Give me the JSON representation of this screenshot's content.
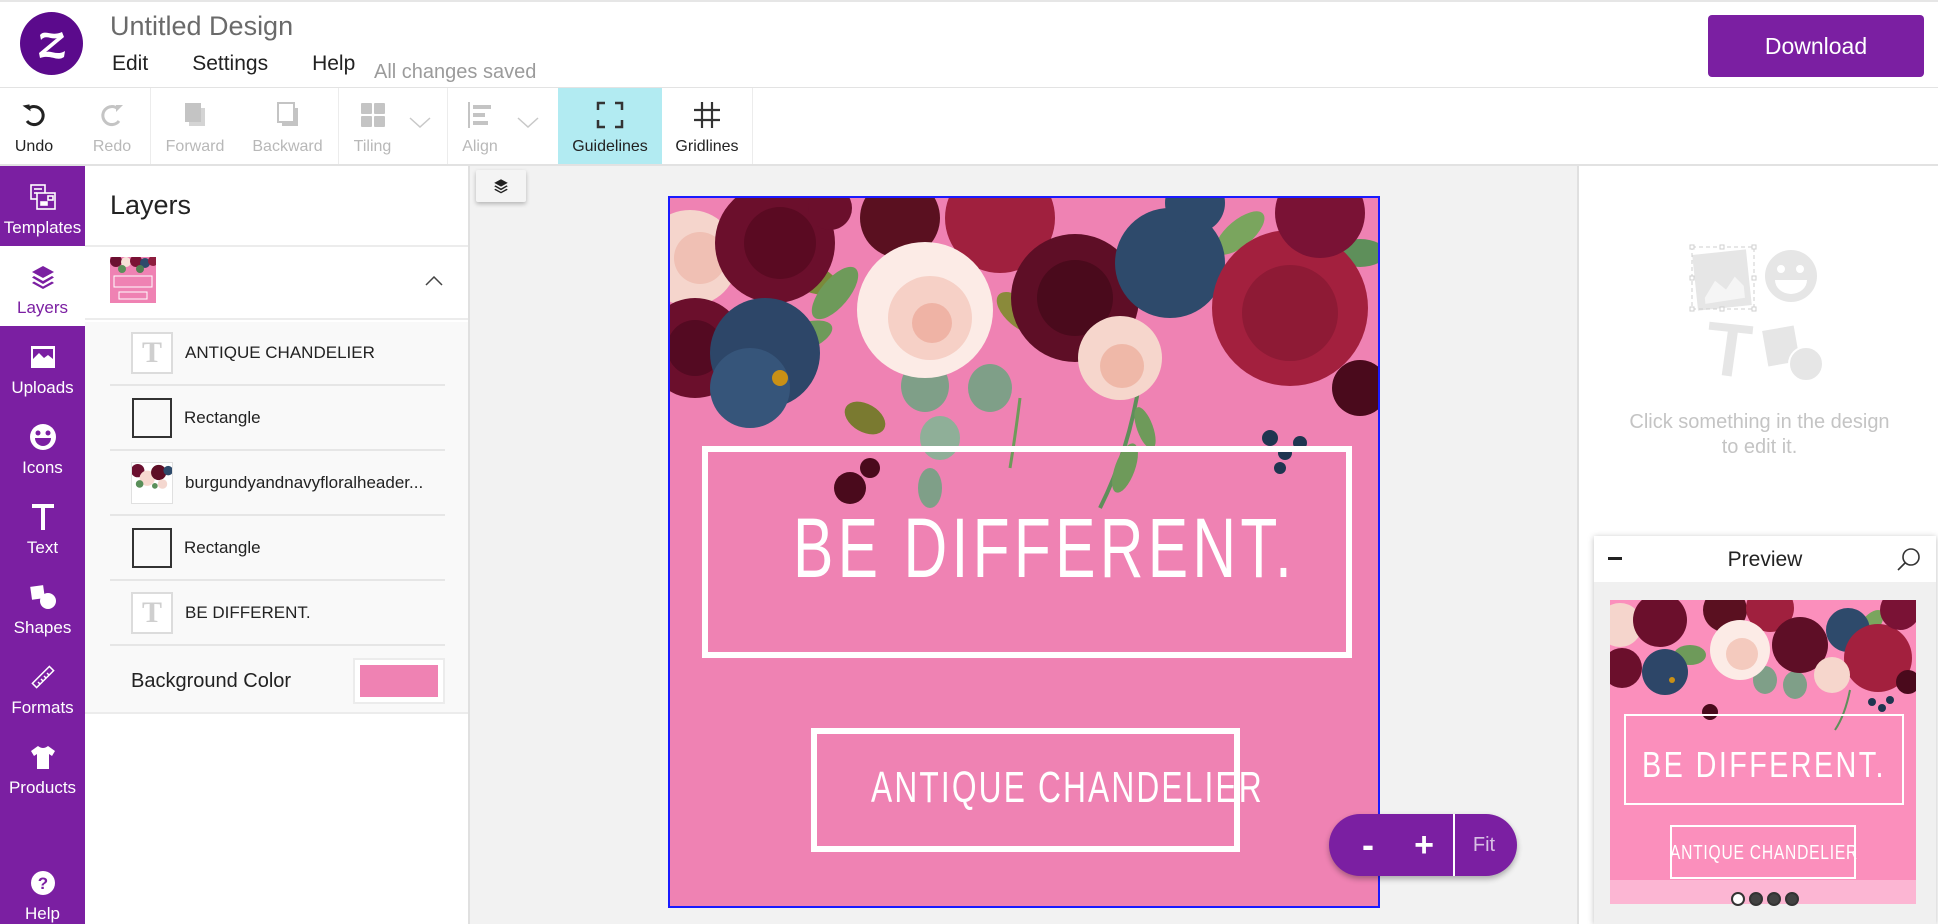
{
  "header": {
    "logo_letter": "z",
    "doc_title": "Untitled Design",
    "menu": [
      "Edit",
      "Settings",
      "Help"
    ],
    "save_status": "All changes saved",
    "download_label": "Download"
  },
  "toolbar": {
    "undo": "Undo",
    "redo": "Redo",
    "forward": "Forward",
    "backward": "Backward",
    "tiling": "Tiling",
    "align": "Align",
    "guidelines": "Guidelines",
    "gridlines": "Gridlines"
  },
  "sidebar": {
    "items": [
      {
        "label": "Templates",
        "icon": "templates-icon"
      },
      {
        "label": "Layers",
        "icon": "layers-icon",
        "active": true
      },
      {
        "label": "Uploads",
        "icon": "image-icon"
      },
      {
        "label": "Icons",
        "icon": "smiley-icon"
      },
      {
        "label": "Text",
        "icon": "text-icon"
      },
      {
        "label": "Shapes",
        "icon": "shapes-icon"
      },
      {
        "label": "Formats",
        "icon": "ruler-icon"
      },
      {
        "label": "Products",
        "icon": "tshirt-icon"
      }
    ],
    "help": "Help"
  },
  "layers": {
    "title": "Layers",
    "items": [
      {
        "type": "text",
        "label": "ANTIQUE CHANDELIER"
      },
      {
        "type": "rect",
        "label": "Rectangle"
      },
      {
        "type": "image",
        "label": "burgundyandnavyfloralheader..."
      },
      {
        "type": "rect",
        "label": "Rectangle"
      },
      {
        "type": "text",
        "label": "BE DIFFERENT."
      }
    ],
    "background_label": "Background Color",
    "background_color": "#ef82b3"
  },
  "design": {
    "title": "BE DIFFERENT.",
    "subtitle": "ANTIQUE CHANDELIER",
    "background": "#ef82b3",
    "selection_color": "#1a1aff"
  },
  "zoom": {
    "minus": "-",
    "plus": "+",
    "fit": "Fit"
  },
  "right_panel": {
    "empty_message_line1": "Click something in the design",
    "empty_message_line2": "to edit it."
  },
  "preview": {
    "title": "Preview",
    "pages": 4,
    "current_page": 1
  },
  "colors": {
    "brand": "#7b1fa2",
    "guidelines_active": "#b2ebf2"
  }
}
